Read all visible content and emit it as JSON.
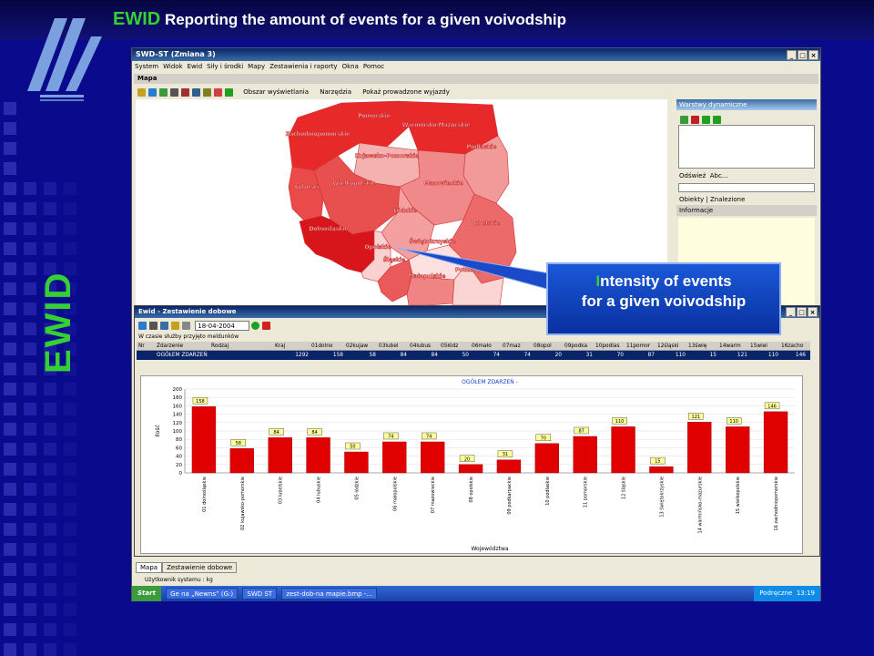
{
  "slide": {
    "title_brand": "EWID",
    "title_rest": " Reporting the amount of events for a given voivodship",
    "vertical_label": "EWID",
    "callout_first_letter": "I",
    "callout_line1_rest": "ntensity of events",
    "callout_line2": "for a given voivodship"
  },
  "app": {
    "title": "SWD-ST (Zmiana 3)",
    "menu": [
      "System",
      "Widok",
      "Ewid",
      "Siły i środki",
      "Mapy",
      "Zestawienia i raporty",
      "Okna",
      "Pomoc"
    ],
    "map_window_title": "Mapa",
    "toolbar": {
      "area": "Obszar wyświetlania",
      "tools": "Narzędzia",
      "show": "Pokaż prowadzone wyjazdy"
    }
  },
  "right_panel": {
    "layers_title": "Warstwy dynamiczne",
    "refresh": "Odśwież",
    "abc": "Abc...",
    "tab_objects": "Obiekty",
    "tab_found": "Znalezione",
    "info_title": "Informacje"
  },
  "map": {
    "regions": [
      {
        "label": "Pomorskie",
        "color": "#e8292a"
      },
      {
        "label": "Warmińsko-Mazurskie",
        "color": "#e8292a"
      },
      {
        "label": "Zachodniopomorskie",
        "color": "#e8292a"
      },
      {
        "label": "Podlaskie",
        "color": "#f29a9a"
      },
      {
        "label": "Kujawsko-Pomorskie",
        "color": "#f5b0b0"
      },
      {
        "label": "Mazowieckie",
        "color": "#f08a8a"
      },
      {
        "label": "Lubuskie",
        "color": "#ea4a4a"
      },
      {
        "label": "Wielkopolskie",
        "color": "#e85050"
      },
      {
        "label": "Łódzkie",
        "color": "#f4a0a0"
      },
      {
        "label": "Lubelskie",
        "color": "#ed6a6a"
      },
      {
        "label": "Dolnośląskie",
        "color": "#d8151a"
      },
      {
        "label": "Opolskie",
        "color": "#fbd0d0"
      },
      {
        "label": "Świętokrzyskie",
        "color": "#fde0e0"
      },
      {
        "label": "Śląskie",
        "color": "#ea5a5a"
      },
      {
        "label": "Małopolskie",
        "color": "#f08484"
      },
      {
        "label": "Podkarpackie",
        "color": "#fbd4d4"
      }
    ]
  },
  "sub_window": {
    "title": "Ewid - Zestawienie dobowe",
    "date": "18-04-2004",
    "note": "W czasie służby przyjęto meldunków",
    "headers": [
      "Nr",
      "Zdarzenie",
      "Rodzaj",
      "Kraj",
      "01dolno",
      "02kujaw",
      "03lubel",
      "04lubus",
      "05łódz",
      "06mało",
      "07maz",
      "08opol",
      "09podka",
      "10podlas",
      "11pomor",
      "12śląski",
      "13świę",
      "14warm",
      "15wiel",
      "16zacho"
    ],
    "row": [
      "",
      "OGÓŁEM ZDARZEŃ",
      "",
      "1292",
      "158",
      "58",
      "84",
      "84",
      "50",
      "74",
      "74",
      "20",
      "31",
      "70",
      "87",
      "110",
      "15",
      "121",
      "110",
      "146"
    ]
  },
  "chart_data": {
    "type": "bar",
    "title": "OGÓŁEM ZDARZEŃ -",
    "xlabel": "Województwa",
    "ylabel": "Ilość",
    "ylim": [
      0,
      200
    ],
    "yticks": [
      0,
      20,
      40,
      60,
      80,
      100,
      120,
      140,
      160,
      180,
      200
    ],
    "categories": [
      "01 dolnośląskie",
      "02 kujawsko-pomorskie",
      "03 lubelskie",
      "04 lubuskie",
      "05 łódzkie",
      "06 małopolskie",
      "07 mazowieckie",
      "08 opolskie",
      "09 podkarpackie",
      "10 podlaskie",
      "11 pomorskie",
      "12 śląskie",
      "13 świętokrzyskie",
      "14 warmińsko-mazurskie",
      "15 wielkopolskie",
      "16 zachodniopomorskie"
    ],
    "values": [
      158,
      58,
      84,
      84,
      50,
      74,
      74,
      20,
      31,
      70,
      87,
      110,
      15,
      121,
      110,
      146
    ],
    "grid": true,
    "bar_color": "#e00000"
  },
  "tabs": [
    "Mapa",
    "Zestawienie dobowe"
  ],
  "status": {
    "user": "Użytkownik systemu : kg"
  },
  "taskbar": {
    "start": "Start",
    "tasks": [
      "Ge na „Newns” (G:)",
      "SWD ST",
      "zest-dob-na mapie.bmp -..."
    ],
    "lang": "Podręczne",
    "time": "13:19"
  }
}
